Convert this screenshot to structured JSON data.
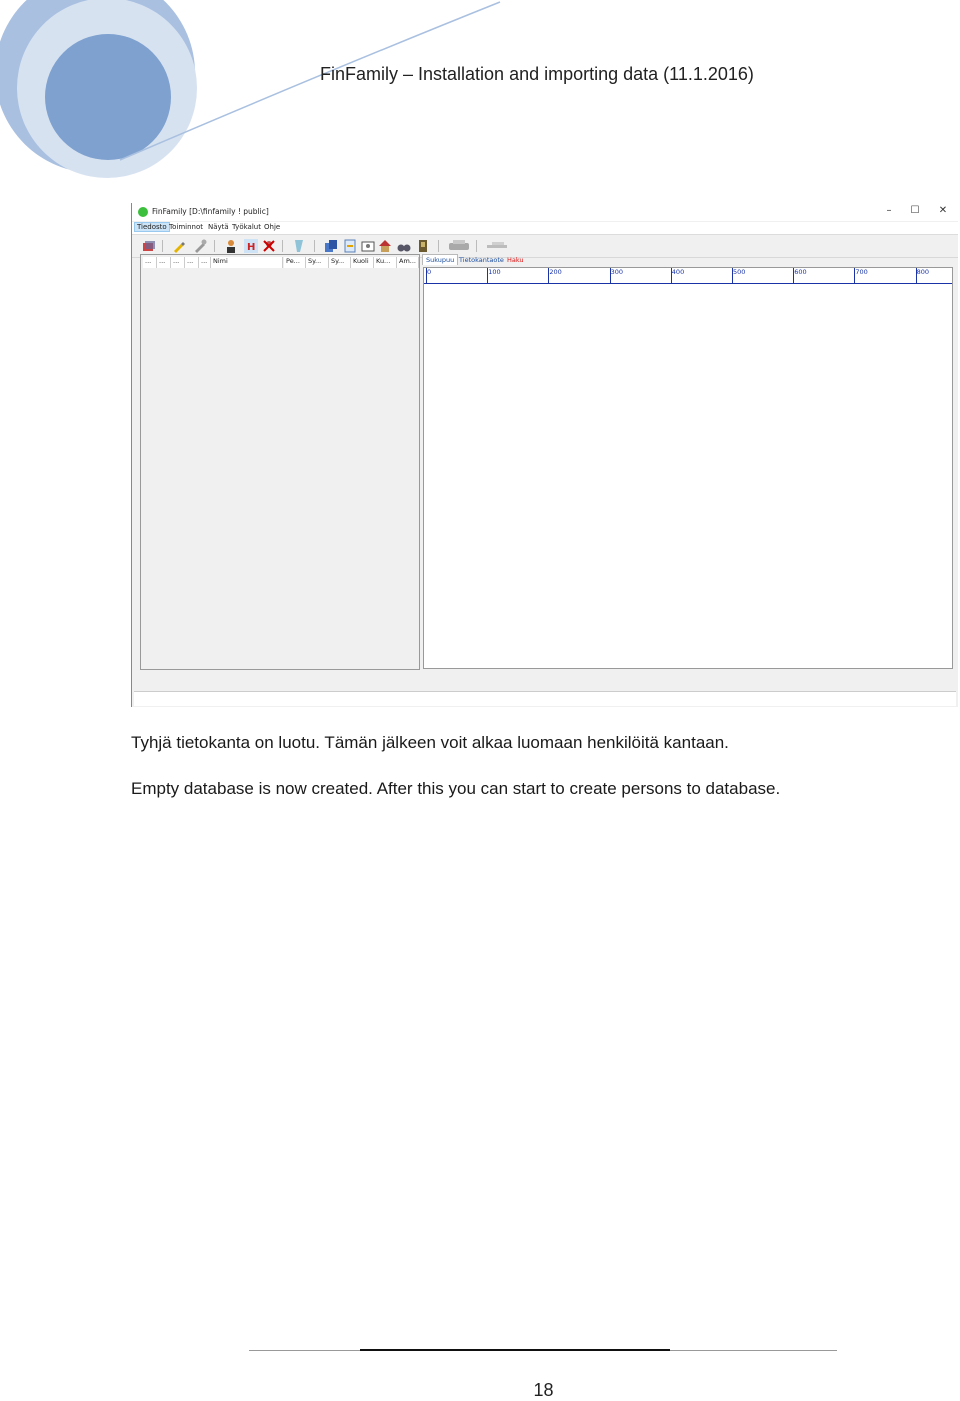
{
  "header": {
    "title": "FinFamily – Installation and importing data (11.1.2016)"
  },
  "screenshot": {
    "window_title": "FinFamily [D:\\finfamily ! public]",
    "window_controls": [
      "–",
      "☐",
      "✕"
    ],
    "menu": [
      "Tiedosto",
      "Toiminnot",
      "Näytä",
      "Työkalut",
      "Ohje"
    ],
    "columns": [
      "...",
      "...",
      "...",
      "...",
      "...",
      "Nimi",
      "Pe...",
      "Sy...",
      "Sy...",
      "Kuoli",
      "Ku...",
      "Am..."
    ],
    "tabs": [
      "Sukupuu",
      "Tietokantaote",
      "Haku"
    ],
    "ruler_labels": [
      "0",
      "100",
      "200",
      "300",
      "400",
      "500",
      "600",
      "700",
      "800"
    ]
  },
  "body": {
    "paragraph_fi": "Tyhjä tietokanta on luotu. Tämän jälkeen voit alkaa luomaan henkilöitä kantaan.",
    "paragraph_en": "Empty database is now created. After this you can start to create persons to database."
  },
  "footer": {
    "page_number": "18"
  },
  "colors": {
    "circle_dark": "#7ea1cf",
    "circle_mid": "#a9c0e0",
    "circle_light": "#d7e2f1",
    "ruler": "#1a34a8",
    "tab_text": "#1c4fa0",
    "tab_alert": "#dd1111"
  }
}
